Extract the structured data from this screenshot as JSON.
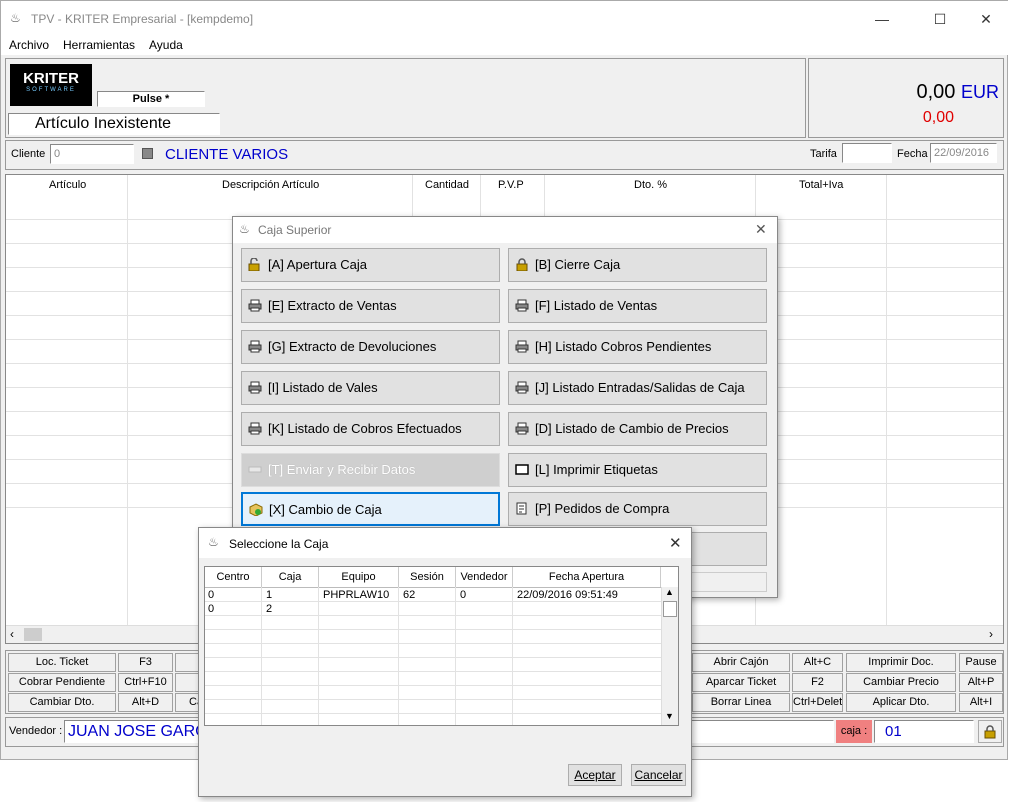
{
  "window": {
    "title": "TPV - KRITER Empresarial -  [kempdemo]"
  },
  "menu": [
    "Archivo",
    "Herramientas",
    "Ayuda"
  ],
  "header": {
    "logo_text": "KRITER",
    "logo_sub": "SOFTWARE",
    "pulse_label": "Pulse *",
    "article_status": "Artículo Inexistente",
    "total_amount": "0,00",
    "currency": "EUR",
    "total_red": "0,00"
  },
  "client": {
    "label": "Cliente",
    "value": "0",
    "name": "CLIENTE VARIOS",
    "tarifa_label": "Tarifa",
    "tarifa_value": "",
    "fecha_label": "Fecha",
    "fecha_value": "22/09/2016"
  },
  "grid": {
    "columns": [
      "Artículo",
      "Descripción Artículo",
      "Cantidad",
      "P.V.P",
      "Dto. %",
      "Total+Iva"
    ]
  },
  "shortcuts": {
    "row1": [
      {
        "label": "Loc. Ticket",
        "key": "F3"
      },
      {
        "label": "Abrir Cajón",
        "key": "Alt+C"
      },
      {
        "label": "Imprimir Doc.",
        "key": "Pause"
      }
    ],
    "row2": [
      {
        "label": "Cobrar Pendiente",
        "key": "Ctrl+F10"
      },
      {
        "label": "Aparcar Ticket",
        "key": "F2"
      },
      {
        "label": "Cambiar Precio",
        "key": "Alt+P"
      }
    ],
    "row3": [
      {
        "label": "Cambiar Dto.",
        "key": "Alt+D"
      },
      {
        "label": "Borrar Linea",
        "key": "Ctrl+Delete"
      },
      {
        "label": "Aplicar Dto.",
        "key": "Alt+I"
      }
    ],
    "row3_partial": "Ca"
  },
  "footer": {
    "vendedor_label": "Vendedor :",
    "vendedor_value": "JUAN JOSE GARC",
    "caja_label": "caja :",
    "caja_value": "01"
  },
  "caja_dialog": {
    "title": "Caja Superior",
    "buttons": [
      {
        "label": "[A] Apertura Caja",
        "icon": "unlock-icon"
      },
      {
        "label": "[B] Cierre Caja",
        "icon": "lock-icon"
      },
      {
        "label": "[E] Extracto de Ventas",
        "icon": "printer-icon"
      },
      {
        "label": "[F] Listado de Ventas",
        "icon": "printer-icon"
      },
      {
        "label": "[G] Extracto de Devoluciones",
        "icon": "printer-icon"
      },
      {
        "label": "[H] Listado Cobros Pendientes",
        "icon": "printer-icon"
      },
      {
        "label": "[I] Listado de Vales",
        "icon": "printer-icon"
      },
      {
        "label": "[J] Listado Entradas/Salidas de Caja",
        "icon": "printer-icon"
      },
      {
        "label": "[K] Listado de Cobros Efectuados",
        "icon": "printer-icon"
      },
      {
        "label": "[D] Listado de Cambio de Precios",
        "icon": "printer-icon"
      },
      {
        "label": "[T] Enviar y Recibir Datos",
        "icon": "transfer-icon",
        "disabled": true
      },
      {
        "label": "[L] Imprimir Etiquetas",
        "icon": "label-icon"
      },
      {
        "label": "[X] Cambio de Caja",
        "icon": "box-icon",
        "focused": true
      },
      {
        "label": "[P] Pedidos de Compra",
        "icon": "order-icon"
      }
    ]
  },
  "select_dialog": {
    "title": "Seleccione la Caja",
    "columns": [
      "Centro",
      "Caja",
      "Equipo",
      "Sesión",
      "Vendedor",
      "Fecha Apertura"
    ],
    "rows": [
      [
        "0",
        "1",
        "PHPRLAW10",
        "62",
        "0",
        "22/09/2016 09:51:49"
      ],
      [
        "0",
        "2",
        "",
        "",
        "",
        ""
      ]
    ],
    "accept": "Aceptar",
    "cancel": "Cancelar"
  }
}
